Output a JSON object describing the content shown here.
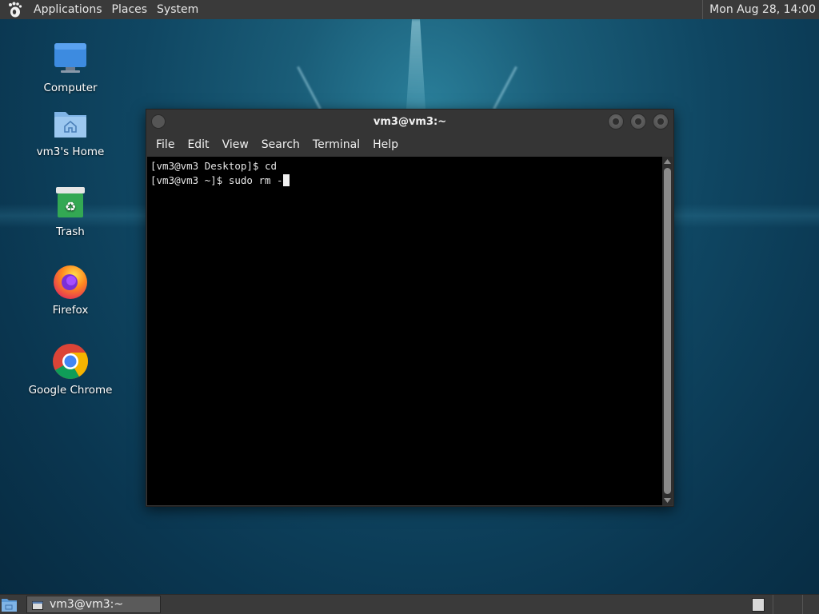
{
  "top_panel": {
    "menus": [
      "Applications",
      "Places",
      "System"
    ],
    "clock": "Mon Aug 28, 14:00"
  },
  "desktop": {
    "icons": [
      {
        "label": "Computer",
        "icon": "computer-icon"
      },
      {
        "label": "vm3's Home",
        "icon": "home-folder-icon"
      },
      {
        "label": "Trash",
        "icon": "trash-icon"
      },
      {
        "label": "Firefox",
        "icon": "firefox-icon"
      },
      {
        "label": "Google Chrome",
        "icon": "chrome-icon"
      }
    ]
  },
  "terminal": {
    "title": "vm3@vm3:~",
    "menu": [
      "File",
      "Edit",
      "View",
      "Search",
      "Terminal",
      "Help"
    ],
    "lines": [
      "[vm3@vm3 Desktop]$ cd",
      "[vm3@vm3 ~]$ sudo rm -"
    ]
  },
  "taskbar": {
    "task_label": "vm3@vm3:~"
  },
  "colors": {
    "panel": "#3a3a3a",
    "terminal_bg": "#000000",
    "wallpaper": "#0f4662"
  }
}
